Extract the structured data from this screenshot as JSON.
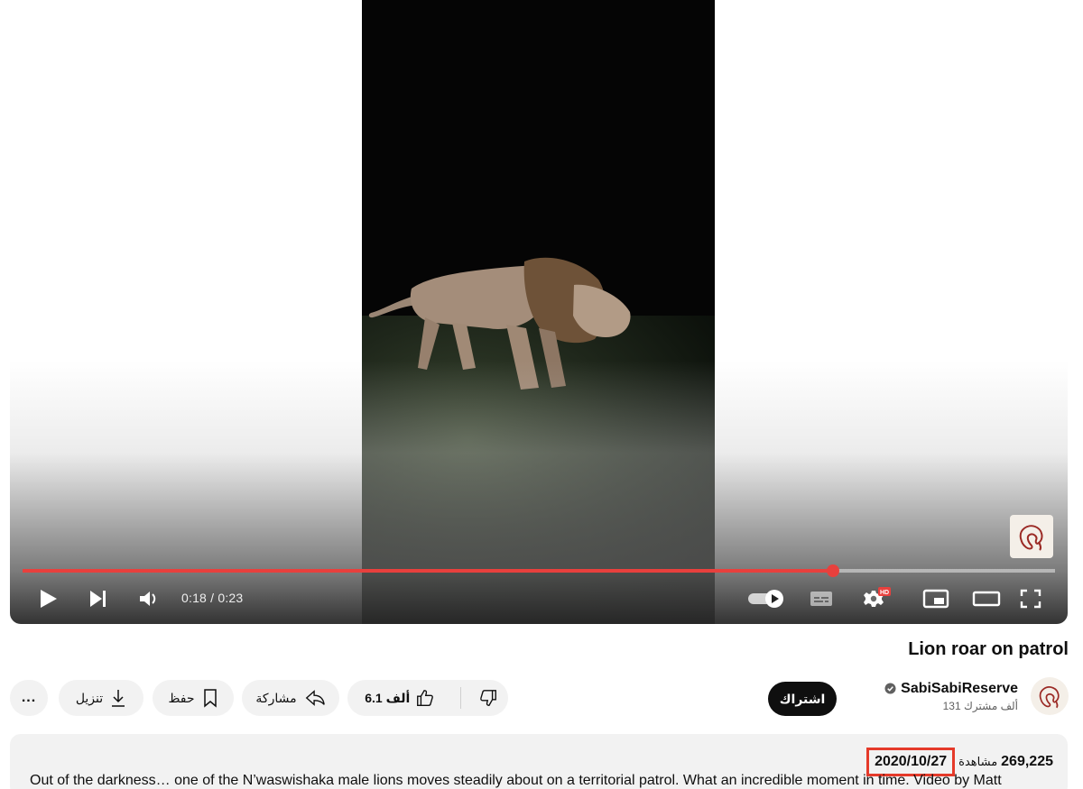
{
  "player": {
    "time_current": "0:18",
    "time_separator": " / ",
    "time_total": "0:23",
    "progress_fraction": 0.785,
    "hd_badge": "HD",
    "icons": [
      "play-icon",
      "next-icon",
      "volume-icon",
      "autoplay-toggle-icon",
      "subtitles-icon",
      "settings-icon",
      "miniplayer-icon",
      "theater-icon",
      "fullscreen-icon"
    ]
  },
  "video": {
    "title": "Lion roar on patrol"
  },
  "channel": {
    "name": "SabiSabiReserve",
    "subscribers": "131 ألف مشترك",
    "subscribe_label": "اشتراك"
  },
  "actions": {
    "like_count": "6.1 ألف",
    "share_label": "مشاركة",
    "save_label": "حفظ",
    "download_label": "تنزيل",
    "more_label": "..."
  },
  "description": {
    "views": "269,225",
    "views_label": "مشاهدة",
    "date": "2020/10/27",
    "text": "Out of the darkness… one of the N’waswishaka male lions moves steadily about on a territorial patrol. What an incredible moment in time. Video by Matt"
  },
  "colors": {
    "accent": "#e8403d",
    "highlight_box": "#e53a2a",
    "pill_bg": "#f2f2f2",
    "subscribe_bg": "#0f0f0f"
  }
}
